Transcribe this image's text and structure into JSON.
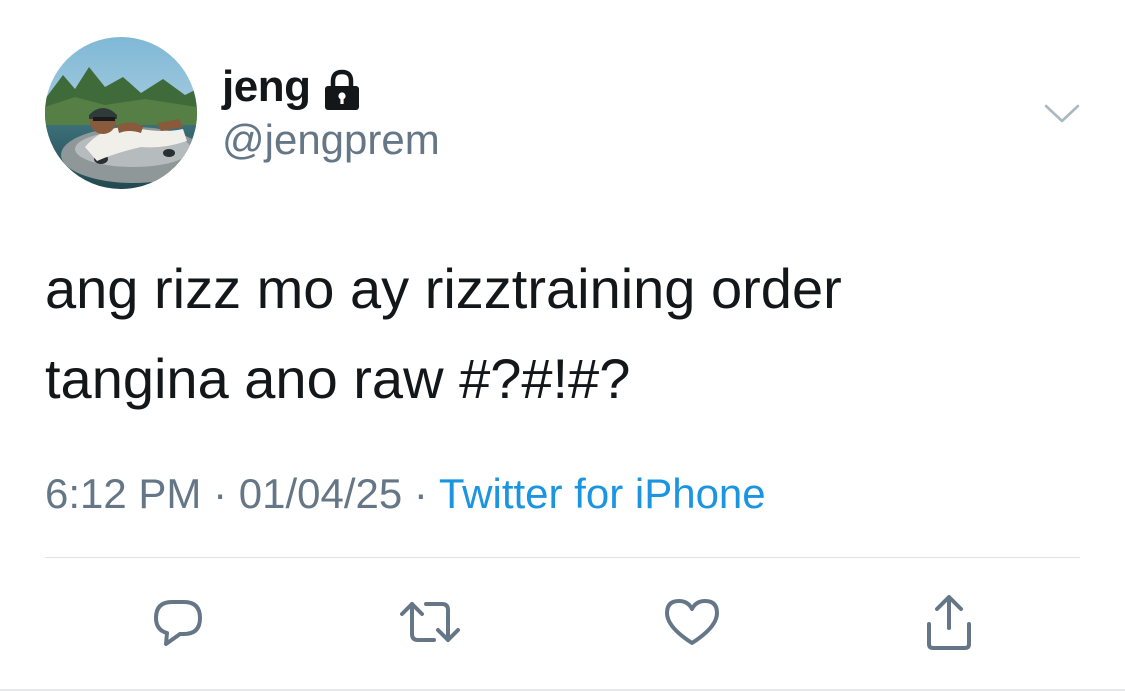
{
  "user": {
    "display_name": "jeng",
    "handle": "@jengprem",
    "protected_icon": "lock-icon",
    "avatar": "profile-photo"
  },
  "tweet": {
    "line1": "ang rizz mo ay rizztraining order",
    "line2": "tangina ano raw #?#!#?"
  },
  "meta": {
    "time": "6:12 PM",
    "separator1": " · ",
    "date": "01/04/25",
    "separator2": " · ",
    "source": "Twitter for iPhone"
  },
  "actions": {
    "reply_icon": "reply-icon",
    "retweet_icon": "retweet-icon",
    "like_icon": "heart-icon",
    "share_icon": "share-icon"
  },
  "menu_icon": "chevron-down-icon",
  "colors": {
    "text_primary": "#14171a",
    "text_secondary": "#657786",
    "link": "#1b95e0",
    "icon": "#657786",
    "divider": "#dfe3e7"
  }
}
